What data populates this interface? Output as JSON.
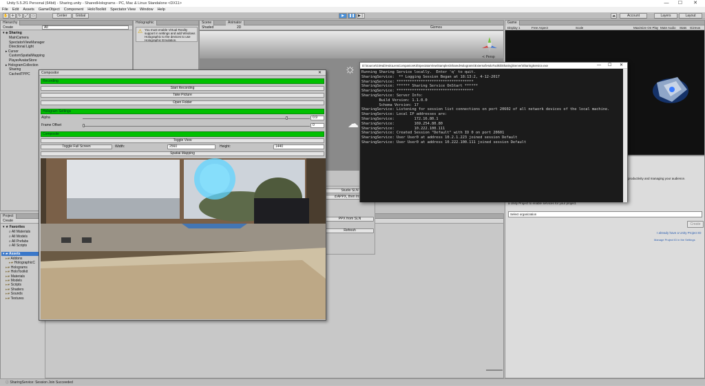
{
  "window": {
    "title": "Unity 5.5.2f1 Personal (64bit) - Sharing.unity - SharedHolograms - PC, Mac & Linux Standalone <DX11>",
    "minimize_glyph": "—",
    "maximize_glyph": "☐",
    "close_glyph": "✕"
  },
  "menu": [
    "File",
    "Edit",
    "Assets",
    "GameObject",
    "Component",
    "HoloToolkit",
    "Spectator View",
    "Window",
    "Help"
  ],
  "toolbar": {
    "pivot": "Center",
    "space": "Global",
    "account": "Account",
    "layers": "Layers",
    "layout": "Layout"
  },
  "hierarchy": {
    "tab": "Hierarchy",
    "create": "Create",
    "search_placeholder": "All",
    "scene": "Sharing",
    "items": [
      "MainCamera",
      "SpectatorViewManager",
      "Directional Light",
      "Cursor",
      "CustomSpatialMapping",
      "PlayerAvatarStore",
      "HologramCollection",
      "Sharing",
      "CachedTPPC"
    ]
  },
  "holographic": {
    "tab": "Holographic",
    "message": "You must enable Virtual Reality support in settings and add Windows Holographic to the devices to use Holographic Emulation."
  },
  "scene": {
    "tab_scene": "Scene",
    "tab_animator": "Animator",
    "shading": "Shaded",
    "mode_2d": "2D",
    "gizmos": "Gizmos",
    "persp": "≺ Persp"
  },
  "game": {
    "tab": "Game",
    "display": "Display 1",
    "aspect": "Free Aspect",
    "scale": "Scale",
    "maximize": "Maximize On Play",
    "mute": "Mute Audio",
    "stats": "Stats",
    "gizmos": "Gizmos"
  },
  "services": {
    "message": "productivity and managing your audience.",
    "link_text": "a Unity Project to enable services for your project.",
    "org_placeholder": "Select organization",
    "create": "Create",
    "already_have": "I already have a Unity Project ID",
    "footer": "Manage Project ID in the Settings"
  },
  "project": {
    "tab": "Project",
    "create": "Create",
    "favorites": "Favorites",
    "fav_items": [
      "All Materials",
      "All Models",
      "All Prefabs",
      "All Scripts"
    ],
    "assets": "Assets",
    "asset_items": [
      "Addons",
      "HolographicC",
      "Holograms",
      "HoloToolkit",
      "Materials",
      "Models",
      "Scripts",
      "Shaders",
      "Sounds",
      "Textures"
    ]
  },
  "compositor": {
    "title": "Compositor",
    "close_glyph": "✕",
    "recording": "Recording",
    "start_recording": "Start Recording",
    "take_picture": "Take Picture",
    "open_folder": "Open Folder",
    "hologram_settings": "Hologram Settings",
    "alpha_label": "Alpha",
    "alpha_value": "0.9",
    "frame_offset_label": "Frame Offset",
    "frame_offset_value": "0",
    "composite": "Composite",
    "toggle_view": "Toggle View",
    "toggle_full_screen": "Toggle Full Screen",
    "width_label": "Width:",
    "width_value": "2560",
    "height_label": "Height:",
    "height_value": "1440",
    "spatial_mapping": "Spatial Mapping"
  },
  "inspector_behind": {
    "studio_sln": "Studio SLN",
    "appx_install": "d APPX, then Install",
    "appx_from_sln": "PPX from SLN",
    "refresh": "Refresh"
  },
  "console": {
    "title": "D:\\Source\\GitHub\\HoloLensCompanionKit\\SpectatorView\\Samples\\SharedHolograms\\External\\HoloToolkit\\Sharing\\Server\\SharingService.exe",
    "lines": [
      "Running Sharing Service locally.  Enter 'q' to quit.",
      "SharingService:  ** Logging Session Began at 18:13:2, 4-12-2017",
      "SharingService: ***********************************",
      "SharingService: ****** Sharing Service OnStart ******",
      "SharingService: ***********************************",
      "SharingService: Server Info:",
      "        Build Version: 1.1.0.0",
      "        Schema Version: 17",
      "SharingService: Listening for session list connections on port 20602 of all network devices of the local machine.",
      "SharingService: Local IP addresses are:",
      "SharingService:         172.16.80.1",
      "SharingService:         169.254.80.80",
      "SharingService:         10.222.100.111",
      "SharingService: Created Session \"Default\" with ID 0 on port 20601",
      "SharingService: User User0 at address 10.2.1.223 joined session Default",
      "SharingService: User User0 at address 10.222.100.111 joined session Default"
    ]
  },
  "status": {
    "text": "SharingService: Session Join Succeeded"
  }
}
